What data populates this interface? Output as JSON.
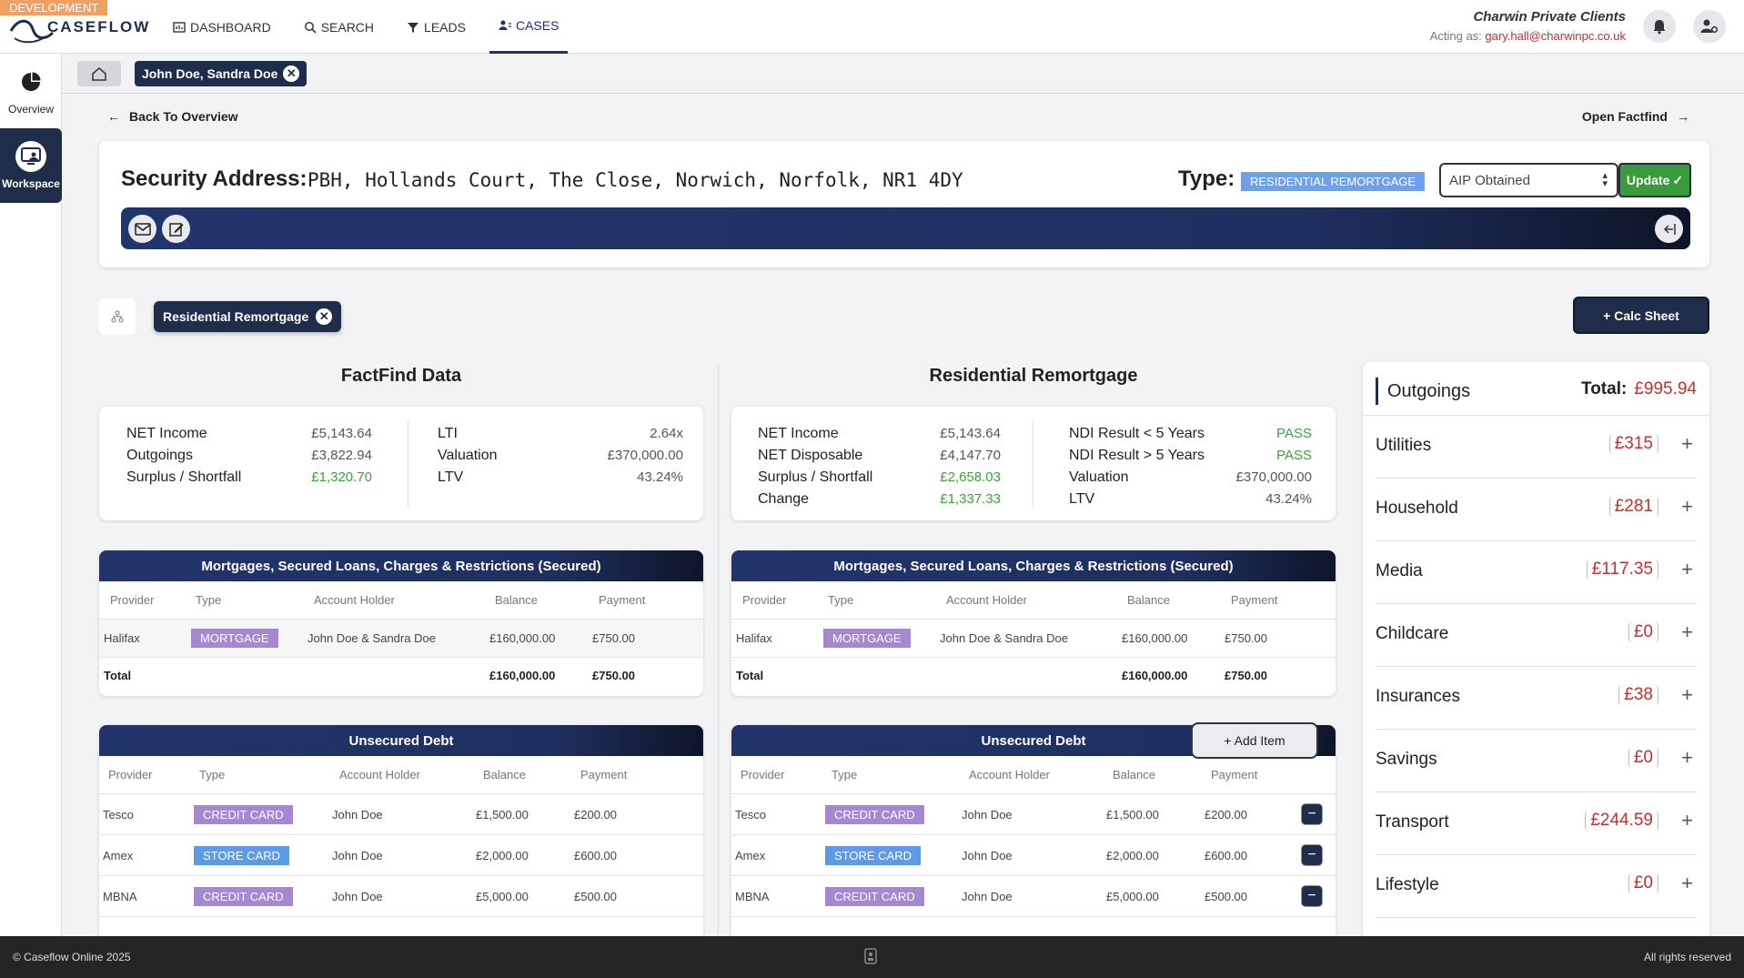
{
  "env_badge": "DEVELOPMENT",
  "logo_text": "CASEFLOW",
  "nav": [
    {
      "label": "DASHBOARD",
      "icon": "dashboard-icon"
    },
    {
      "label": "SEARCH",
      "icon": "search-icon"
    },
    {
      "label": "LEADS",
      "icon": "filter-icon"
    },
    {
      "label": "CASES",
      "icon": "users-icon",
      "active": true
    }
  ],
  "org": {
    "name": "Charwin Private Clients",
    "acting_label": "Acting as:",
    "acting_user": "gary.hall@charwinpc.co.uk"
  },
  "sidebar": [
    {
      "label": "Overview",
      "icon": "pie-chart-icon"
    },
    {
      "label": "Workspace",
      "icon": "workspace-icon",
      "active": true
    }
  ],
  "case_tab": "John Doe, Sandra Doe",
  "back_link": "Back To Overview",
  "open_factfind": "Open Factfind",
  "security": {
    "label": "Security Address:",
    "address": "PBH, Hollands Court, The Close, Norwich, Norfolk, NR1 4DY",
    "type_label": "Type:",
    "type_badge": "RESIDENTIAL REMORTGAGE",
    "status_value": "AIP Obtained",
    "update_label": "Update"
  },
  "subtab": "Residential Remortgage",
  "calc_sheet": "+ Calc Sheet",
  "factfind": {
    "title": "FactFind Data",
    "left": [
      {
        "k": "NET Income",
        "v": "£5,143.64"
      },
      {
        "k": "Outgoings",
        "v": "£3,822.94"
      },
      {
        "k": "Surplus / Shortfall",
        "v": "£1,320.70",
        "green": true
      }
    ],
    "right": [
      {
        "k": "LTI",
        "v": "2.64x"
      },
      {
        "k": "Valuation",
        "v": "£370,000.00"
      },
      {
        "k": "LTV",
        "v": "43.24%"
      }
    ]
  },
  "remortgage": {
    "title": "Residential Remortgage",
    "left": [
      {
        "k": "NET Income",
        "v": "£5,143.64"
      },
      {
        "k": "NET Disposable",
        "v": "£4,147.70"
      },
      {
        "k": "Surplus / Shortfall",
        "v": "£2,658.03",
        "green": true
      },
      {
        "k": "Change",
        "v": "£1,337.33",
        "green": true
      }
    ],
    "right": [
      {
        "k": "NDI Result < 5 Years",
        "v": "PASS",
        "green": true
      },
      {
        "k": "NDI Result > 5 Years",
        "v": "PASS",
        "green": true
      },
      {
        "k": "Valuation",
        "v": "£370,000.00"
      },
      {
        "k": "LTV",
        "v": "43.24%"
      }
    ]
  },
  "secured": {
    "title": "Mortgages, Secured Loans, Charges & Restrictions (Secured)",
    "headers": [
      "Provider",
      "Type",
      "Account Holder",
      "Balance",
      "Payment"
    ],
    "rows": [
      {
        "provider": "Halifax",
        "type": "MORTGAGE",
        "holder": "John Doe & Sandra Doe",
        "balance": "£160,000.00",
        "payment": "£750.00"
      }
    ],
    "total": {
      "label": "Total",
      "balance": "£160,000.00",
      "payment": "£750.00"
    }
  },
  "unsecured": {
    "title": "Unsecured Debt",
    "add_item": "+ Add Item",
    "headers": [
      "Provider",
      "Type",
      "Account Holder",
      "Balance",
      "Payment"
    ],
    "rows": [
      {
        "provider": "Tesco",
        "type": "CREDIT CARD",
        "color": "purple",
        "holder": "John Doe",
        "balance": "£1,500.00",
        "payment": "£200.00"
      },
      {
        "provider": "Amex",
        "type": "STORE CARD",
        "color": "blue",
        "holder": "John Doe",
        "balance": "£2,000.00",
        "payment": "£600.00"
      },
      {
        "provider": "MBNA",
        "type": "CREDIT CARD",
        "color": "purple",
        "holder": "John Doe",
        "balance": "£5,000.00",
        "payment": "£500.00"
      }
    ]
  },
  "outgoings": {
    "title": "Outgoings",
    "total_label": "Total:",
    "total": "£995.94",
    "items": [
      {
        "name": "Utilities",
        "amount": "£315"
      },
      {
        "name": "Household",
        "amount": "£281"
      },
      {
        "name": "Media",
        "amount": "£117.35"
      },
      {
        "name": "Childcare",
        "amount": "£0"
      },
      {
        "name": "Insurances",
        "amount": "£38"
      },
      {
        "name": "Savings",
        "amount": "£0"
      },
      {
        "name": "Transport",
        "amount": "£244.59"
      },
      {
        "name": "Lifestyle",
        "amount": "£0"
      }
    ]
  },
  "footer": {
    "left": "© Caseflow Online 2025",
    "right": "All rights reserved"
  }
}
